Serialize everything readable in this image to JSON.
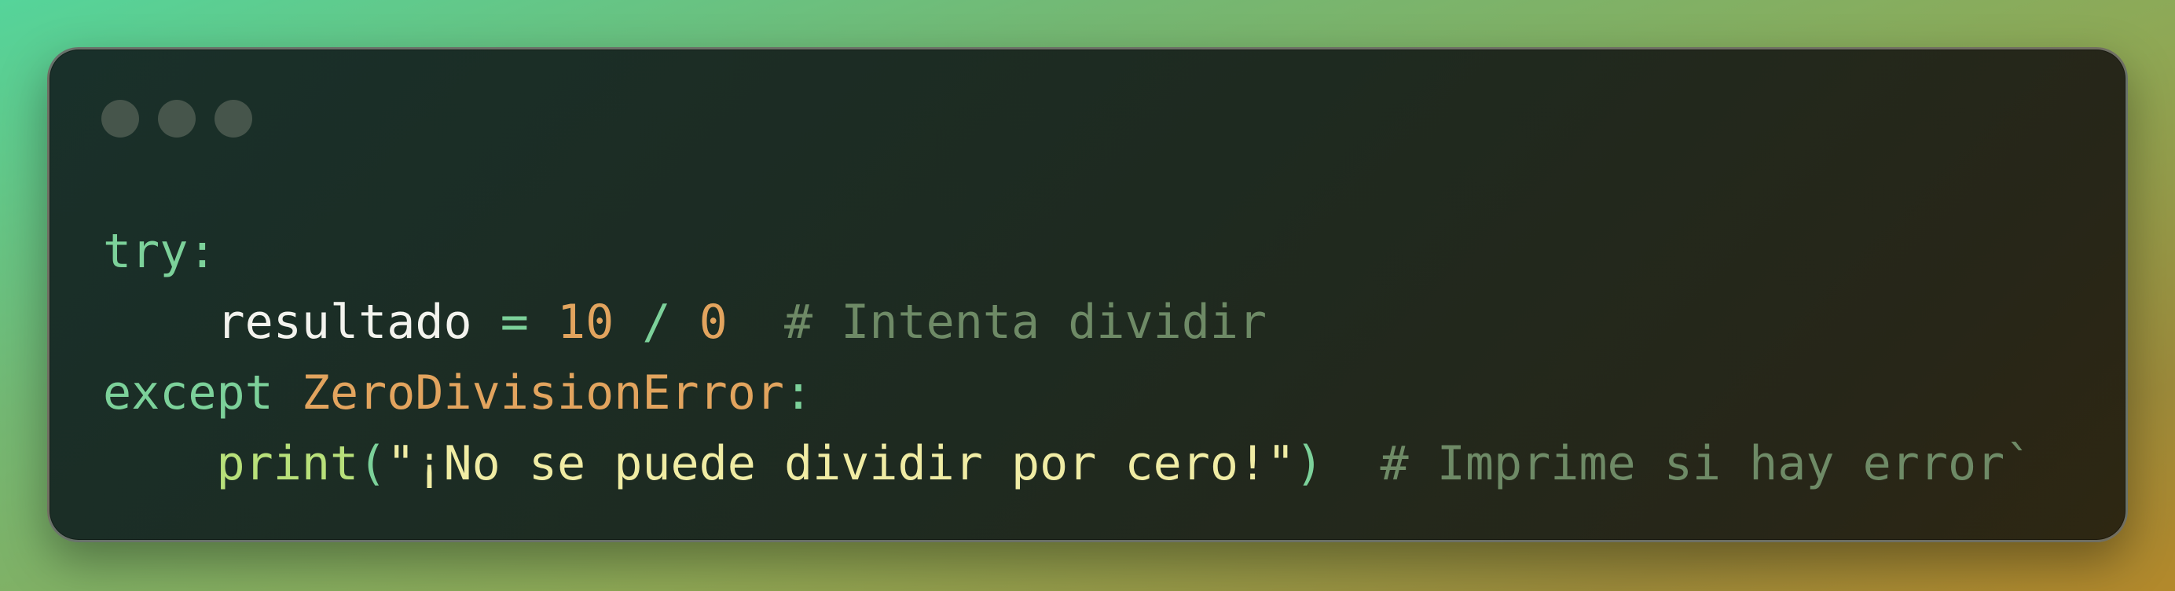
{
  "window": {
    "controls": [
      "close-dot",
      "minimize-dot",
      "maximize-dot"
    ]
  },
  "code": {
    "language": "python",
    "lines": [
      {
        "kw_try": "try:"
      },
      {
        "indent": "    ",
        "var": "resultado",
        "op": " = ",
        "num1": "10",
        "div": " / ",
        "num2": "0",
        "comment": "  # Intenta dividir"
      },
      {
        "kw_except": "except",
        "space": " ",
        "cls": "ZeroDivisionError",
        "colon": ":"
      },
      {
        "indent": "    ",
        "fn": "print",
        "lparen": "(",
        "str": "\"¡No se puede dividir por cero!\"",
        "rparen": ")",
        "comment": "  # Imprime si hay error`"
      }
    ]
  },
  "colors": {
    "keyword": "#7cd19a",
    "number": "#e2a45e",
    "string": "#f0eca4",
    "comment": "#6e8a66",
    "function": "#b8e07a",
    "identifier": "#f3f3ee"
  }
}
